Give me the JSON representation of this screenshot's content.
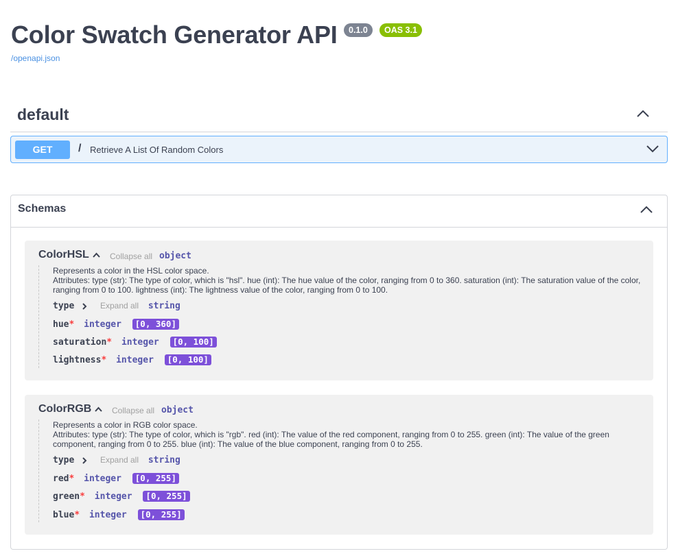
{
  "info": {
    "title": "Color Swatch Generator API",
    "version": "0.1.0",
    "oas": "OAS 3.1",
    "spec_link": "/openapi.json"
  },
  "tag": {
    "name": "default"
  },
  "operation": {
    "method": "GET",
    "path": "/",
    "summary": "Retrieve A List Of Random Colors"
  },
  "schemas": {
    "title": "Schemas",
    "models": [
      {
        "name": "ColorHSL",
        "collapse_label": "Collapse all",
        "type": "object",
        "desc_line1": "Represents a color in the HSL color space.",
        "desc_line2": "Attributes: type (str): The type of color, which is \"hsl\". hue (int): The hue value of the color, ranging from 0 to 360. saturation (int): The saturation value of the color, ranging from 0 to 100. lightness (int): The lightness value of the color, ranging from 0 to 100.",
        "props": [
          {
            "name": "type",
            "expand_label": "Expand all",
            "type": "string"
          },
          {
            "name": "hue",
            "required": "*",
            "type": "integer",
            "range": "[0, 360]"
          },
          {
            "name": "saturation",
            "required": "*",
            "type": "integer",
            "range": "[0, 100]"
          },
          {
            "name": "lightness",
            "required": "*",
            "type": "integer",
            "range": "[0, 100]"
          }
        ]
      },
      {
        "name": "ColorRGB",
        "collapse_label": "Collapse all",
        "type": "object",
        "desc_line1": "Represents a color in RGB color space.",
        "desc_line2": "Attributes: type (str): The type of color, which is \"rgb\". red (int): The value of the red component, ranging from 0 to 255. green (int): The value of the green component, ranging from 0 to 255. blue (int): The value of the blue component, ranging from 0 to 255.",
        "props": [
          {
            "name": "type",
            "expand_label": "Expand all",
            "type": "string"
          },
          {
            "name": "red",
            "required": "*",
            "type": "integer",
            "range": "[0, 255]"
          },
          {
            "name": "green",
            "required": "*",
            "type": "integer",
            "range": "[0, 255]"
          },
          {
            "name": "blue",
            "required": "*",
            "type": "integer",
            "range": "[0, 255]"
          }
        ]
      }
    ]
  },
  "colors": {
    "get_accent": "#61affe",
    "get_bg": "#ebf3fb",
    "range_badge": "#7d50d9",
    "oas_badge": "#89bf04",
    "version_badge": "#7d8492"
  },
  "icons": {
    "tag_toggle": "chevron-up-icon",
    "op_toggle": "chevron-down-icon",
    "schemas_toggle": "chevron-up-icon"
  }
}
